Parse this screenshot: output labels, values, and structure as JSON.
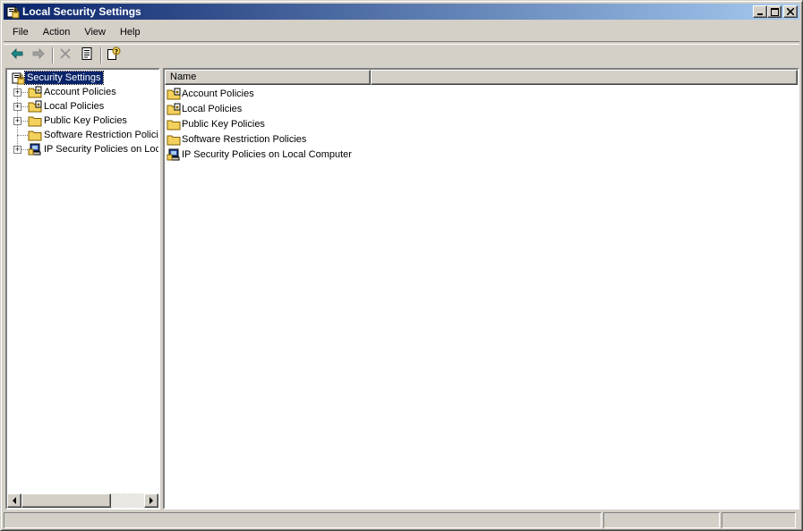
{
  "window": {
    "title": "Local Security Settings"
  },
  "titlebar_buttons": {
    "minimize": "_",
    "maximize": "□",
    "close": "×"
  },
  "menu": [
    {
      "label": "File"
    },
    {
      "label": "Action"
    },
    {
      "label": "View"
    },
    {
      "label": "Help"
    }
  ],
  "toolbar": {
    "icons": [
      "back-arrow-icon",
      "forward-arrow-icon",
      "delete-icon",
      "properties-icon",
      "help-icon"
    ]
  },
  "tree": {
    "root": {
      "label": "Security Settings",
      "icon": "security-settings-icon",
      "selected": true
    },
    "items": [
      {
        "label": "Account Policies",
        "icon": "policy-folder-icon",
        "expandable": true
      },
      {
        "label": "Local Policies",
        "icon": "policy-folder-icon",
        "expandable": true
      },
      {
        "label": "Public Key Policies",
        "icon": "folder-icon",
        "expandable": true
      },
      {
        "label": "Software Restriction Policies",
        "icon": "folder-icon",
        "expandable": false
      },
      {
        "label": "IP Security Policies on Local Computer",
        "icon": "ip-security-icon",
        "expandable": true
      }
    ]
  },
  "list": {
    "columns": [
      {
        "label": "Name"
      },
      {
        "label": ""
      }
    ],
    "rows": [
      {
        "name": "Account Policies",
        "icon": "policy-folder-icon"
      },
      {
        "name": "Local Policies",
        "icon": "policy-folder-icon"
      },
      {
        "name": "Public Key Policies",
        "icon": "folder-icon"
      },
      {
        "name": "Software Restriction Policies",
        "icon": "folder-icon"
      },
      {
        "name": "IP Security Policies on Local Computer",
        "icon": "ip-security-icon"
      }
    ]
  },
  "status": {
    "cells": [
      "",
      "",
      ""
    ]
  },
  "colors": {
    "titlebar_start": "#0a246a",
    "titlebar_end": "#a6caf0",
    "selection": "#0a246a",
    "face": "#d4d0c8",
    "folder": "#f4d15c",
    "toolbar_arrow": "#1c8a8a"
  }
}
